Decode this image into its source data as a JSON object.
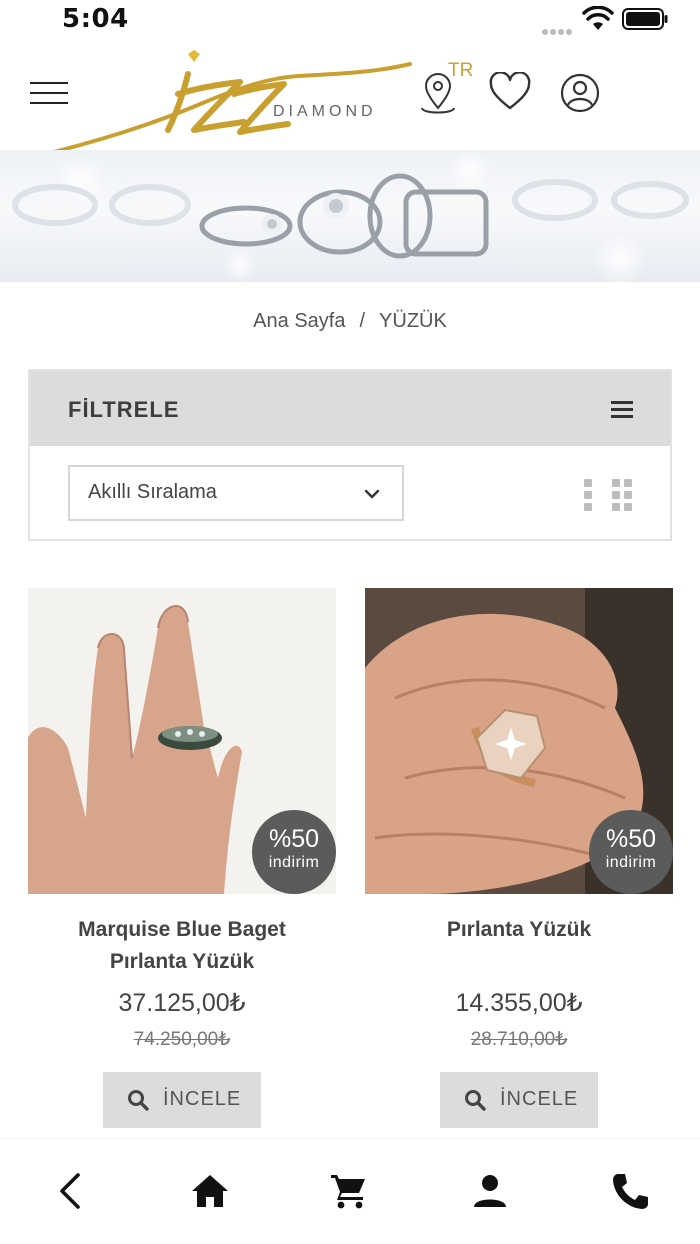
{
  "status_bar": {
    "time": "5:04"
  },
  "header": {
    "brand": "izz",
    "brand_sub": "DIAMOND",
    "language": "TR",
    "icons": [
      "menu-icon",
      "location-pin-icon",
      "heart-icon",
      "user-icon"
    ]
  },
  "breadcrumb": {
    "home": "Ana Sayfa",
    "separator": "/",
    "current": "YÜZÜK"
  },
  "filter": {
    "title": "FİLTRELE",
    "sort_value": "Akıllı Sıralama"
  },
  "products": [
    {
      "name_line1": "Marquise Blue Baget",
      "name_line2": "Pırlanta Yüzük",
      "price": "37.125,00₺",
      "old_price": "74.250,00₺",
      "badge_percent": "%50",
      "badge_text": "indirim",
      "button_label": "İNCELE"
    },
    {
      "name_line1": "Pırlanta Yüzük",
      "name_line2": "",
      "price": "14.355,00₺",
      "old_price": "28.710,00₺",
      "badge_percent": "%50",
      "badge_text": "indirim",
      "button_label": "İNCELE"
    }
  ],
  "bottom_nav": [
    "back-icon",
    "home-icon",
    "cart-icon",
    "account-icon",
    "phone-icon"
  ],
  "colors": {
    "gold": "#c9a030",
    "badge": "#5b5b5b",
    "filter_bg": "#dcdcdc"
  }
}
